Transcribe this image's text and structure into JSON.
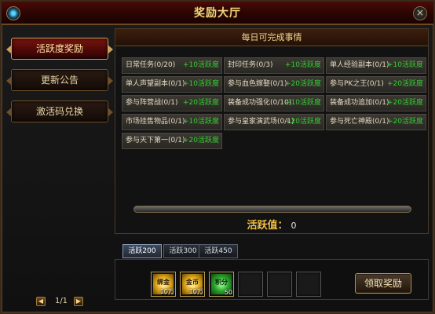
{
  "window": {
    "title": "奖励大厅",
    "close_glyph": "×"
  },
  "sidebar": {
    "items": [
      {
        "label": "活跃度奖励"
      },
      {
        "label": "更新公告"
      },
      {
        "label": "激活码兑换"
      }
    ],
    "pager": {
      "text": "1/1",
      "prev": "◀",
      "next": "▶"
    }
  },
  "main": {
    "header": "每日可完成事情",
    "tasks": [
      {
        "name": "日常任务(0/20)",
        "reward": "+10活跃度"
      },
      {
        "name": "封印任务(0/3)",
        "reward": "+10活跃度"
      },
      {
        "name": "单人经验副本(0/1)",
        "reward": "+10活跃度"
      },
      {
        "name": "单人声望副本(0/1)",
        "reward": "+10活跃度"
      },
      {
        "name": "参与血色嫁娶(0/1)",
        "reward": "+20活跃度"
      },
      {
        "name": "参与PK之王(0/1)",
        "reward": "+20活跃度"
      },
      {
        "name": "参与阵营战(0/1)",
        "reward": "+20活跃度"
      },
      {
        "name": "装备成功强化(0/10)",
        "reward": "+10活跃度"
      },
      {
        "name": "装备成功追加(0/1)",
        "reward": "+20活跃度"
      },
      {
        "name": "市场挂售物品(0/1)",
        "reward": "+10活跃度"
      },
      {
        "name": "参与皇家演武场(0/1)",
        "reward": "+20活跃度"
      },
      {
        "name": "参与死亡神殿(0/1)",
        "reward": "+20活跃度"
      },
      {
        "name": "参与天下第一(0/1)",
        "reward": "+20活跃度"
      }
    ],
    "activity": {
      "label": "活跃值：",
      "value": "0",
      "progress": 0
    }
  },
  "tabs": [
    {
      "label": "活跃200"
    },
    {
      "label": "活跃300"
    },
    {
      "label": "活跃450"
    }
  ],
  "rewards": {
    "items": [
      {
        "label": "绑金",
        "qty": "10万",
        "color": "#d39b14"
      },
      {
        "label": "金币",
        "qty": "10万",
        "color": "#d39b14"
      },
      {
        "label": "积分",
        "qty": "50",
        "color": "#2aa02a"
      }
    ],
    "claim_label": "领取奖励"
  },
  "colors": {
    "accent": "#f1d48a",
    "reward_green": "#31d031",
    "active_tab": "#8a9ab5"
  }
}
